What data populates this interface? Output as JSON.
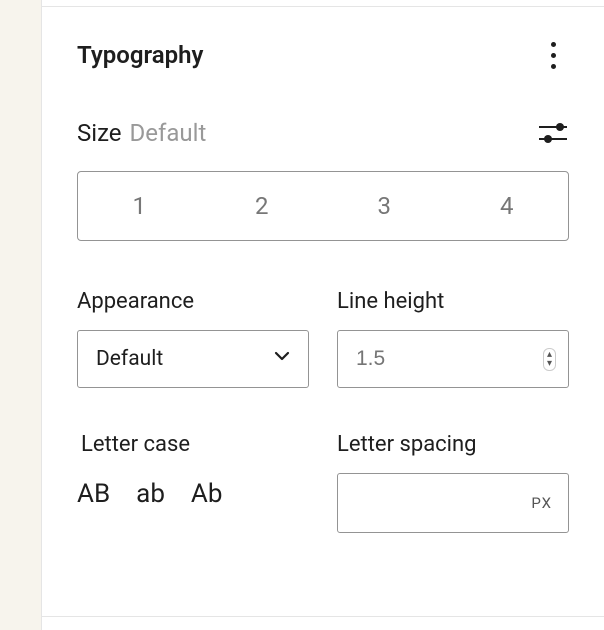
{
  "section": {
    "title": "Typography"
  },
  "size": {
    "label": "Size",
    "current": "Default",
    "options": [
      "1",
      "2",
      "3",
      "4"
    ]
  },
  "appearance": {
    "label": "Appearance",
    "value": "Default"
  },
  "lineHeight": {
    "label": "Line height",
    "placeholder": "1.5"
  },
  "letterCase": {
    "label": "Letter case",
    "options": [
      "AB",
      "ab",
      "Ab"
    ]
  },
  "letterSpacing": {
    "label": "Letter spacing",
    "unit": "PX"
  }
}
